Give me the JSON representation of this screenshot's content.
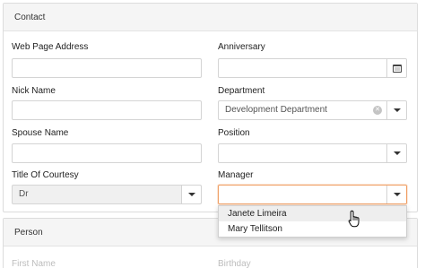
{
  "contact": {
    "title": "Contact",
    "web_page_address": {
      "label": "Web Page Address",
      "value": ""
    },
    "anniversary": {
      "label": "Anniversary",
      "value": "",
      "icon": "calendar-icon"
    },
    "nick_name": {
      "label": "Nick Name",
      "value": ""
    },
    "department": {
      "label": "Department",
      "value": "Development Department"
    },
    "spouse_name": {
      "label": "Spouse Name",
      "value": ""
    },
    "position": {
      "label": "Position",
      "value": ""
    },
    "title_of_courtesy": {
      "label": "Title Of Courtesy",
      "value": "Dr"
    },
    "manager": {
      "label": "Manager",
      "value": "",
      "options": [
        "Janete Limeira",
        "Mary Tellitson"
      ]
    }
  },
  "person": {
    "title": "Person",
    "first_name_label": "First Name",
    "birthday_label": "Birthday"
  },
  "colors": {
    "focus_border": "#f0a066",
    "hover_item": "#eeeeee"
  }
}
